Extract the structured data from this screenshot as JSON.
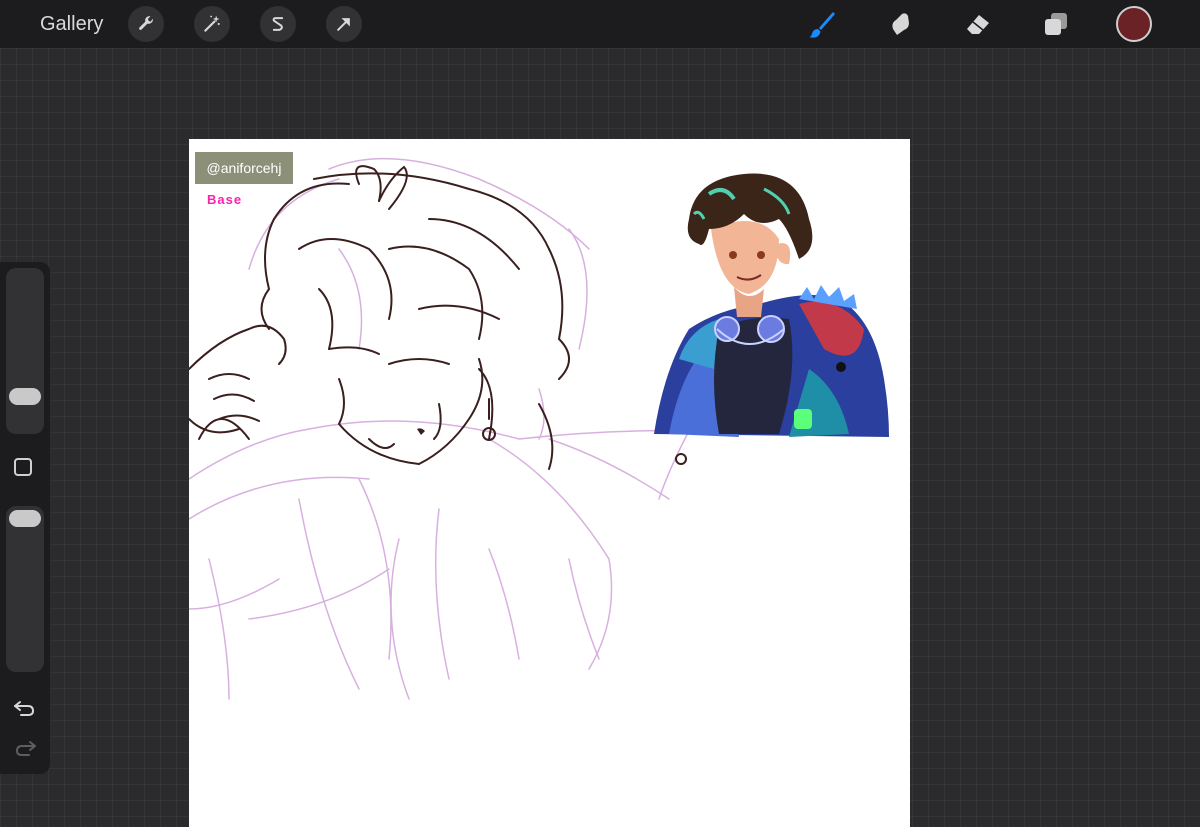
{
  "topbar": {
    "gallery_label": "Gallery",
    "left_tools": [
      "wrench-icon",
      "magic-wand-icon",
      "selection-s-icon",
      "transform-arrow-icon"
    ],
    "right_tools": [
      "brush-icon",
      "smudge-icon",
      "eraser-icon",
      "layers-icon"
    ],
    "active_tool": "brush-icon",
    "accent_color": "#1a8cff",
    "current_color": "#6b2226"
  },
  "canvas": {
    "watermark_text": "@aniforcehj",
    "base_label": "Base",
    "sketch_line_color": "#3a1f1f",
    "sketch_guide_color": "#d8b0e0"
  },
  "sidebar": {
    "size_slider_level": 0.78,
    "opacity_slider_level": 0.05
  }
}
